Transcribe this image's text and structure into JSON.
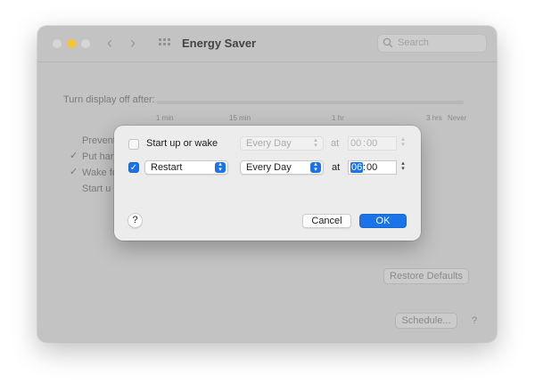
{
  "window": {
    "title": "Energy Saver",
    "search_placeholder": "Search",
    "back_glyph": "‹",
    "forward_glyph": "›"
  },
  "background": {
    "turn_display_off_label": "Turn display off after:",
    "slider_ticks": [
      "1 min",
      "15 min",
      "1 hr",
      "3 hrs",
      "Never"
    ],
    "options": [
      {
        "label": "Prevent",
        "checked": false
      },
      {
        "label": "Put har",
        "checked": true
      },
      {
        "label": "Wake fo",
        "checked": true
      },
      {
        "label": "Start u",
        "checked": false
      }
    ],
    "restore_defaults_label": "Restore Defaults",
    "schedule_label": "Schedule...",
    "help_glyph": "?"
  },
  "dialog": {
    "row1": {
      "checked": false,
      "label": "Start up or wake",
      "repeat": "Every Day",
      "at_label": "at",
      "time_hours": "00",
      "time_minutes": "00"
    },
    "row2": {
      "checked": true,
      "action": "Restart",
      "repeat": "Every Day",
      "at_label": "at",
      "time_hours": "06",
      "time_minutes": "00"
    },
    "help_glyph": "?",
    "cancel_label": "Cancel",
    "ok_label": "OK"
  },
  "colors": {
    "accent": "#1a73e8",
    "minimize": "#f5c431",
    "window_dimmed": "#c3c3c3",
    "dialog_bg": "#ececec"
  },
  "checkmark_glyph": "✓",
  "popup_arrow_glyph": "▴▾"
}
